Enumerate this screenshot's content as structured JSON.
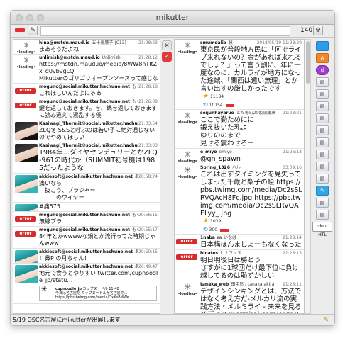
{
  "window": {
    "title": "mikutter"
  },
  "toolbar": {
    "post_placeholder": "",
    "char_count": "140",
    "settings_glyph": "⚙",
    "account_glyph": "✎"
  },
  "left_timeline": [
    {
      "avatar": "loading",
      "name": "hina@mstdn.maud.io",
      "sub": "五十嵐響子(JC13)",
      "time": "21:28:23",
      "text": "まあそうだよね"
    },
    {
      "avatar": "loading",
      "name": "unlimish@mstdn.maud.io",
      "sub": "Unlimish",
      "time": "21:28:12",
      "text": "https://mstdn.maud.io/media/8WW8nTItZx_d0vbvgLQ\nMikutterのゴリゴリオープンソースって感じな",
      "link": "https://mstdn.maud.io/media/8WW8nTItZx_d0vbvgLQ"
    },
    {
      "avatar": "error",
      "name": "moguno@social.mikutter.hachune.net",
      "sub": "もぐの",
      "time": "21:28:18",
      "text": "これほしいんだよにゃあ"
    },
    {
      "avatar": "error",
      "name": "moguno@social.mikutter.hachune.net",
      "sub": "もぐの",
      "time": "21:26:08",
      "text": "鍵を返しておきます。を、鍋を返しておきますに読み違えて混乱する僕"
    },
    {
      "avatar": "dark",
      "name": "Kasiwagi_Thermit@social.mikutter.hachune.net",
      "sub": "",
      "time": "21:03:54",
      "text": "ZLQ冬 S&Sと呼ぶのは若い子に絶対通じないのでやめてほしい"
    },
    {
      "avatar": "dark",
      "name": "Kasiwagi_Thermit@social.mikutter.hachune.net",
      "sub": "",
      "time": "21:03:03",
      "text": "1984年…ダイヤセンチュリーとかZLQ-961の時代か（SUMMIT初号機は1985だったような",
      "big": true
    },
    {
      "avatar": "anime",
      "name": "akkiesoft@social.mikutter.hachune.net",
      "sub": "あっきー",
      "time": "20:58:24",
      "text": "痛いなら\n　抜こう、プラジャー\n　　　のワイヤー"
    },
    {
      "avatar": "anime",
      "name": "",
      "sub": "",
      "time": "",
      "text": "#痛575",
      "link": "#痛575"
    },
    {
      "avatar": "error",
      "name": "moguno@social.mikutter.hachune.net",
      "sub": "もぐの",
      "time": "20:56:15",
      "text": "無線ブラ"
    },
    {
      "avatar": "error",
      "name": "moguno@social.mikutter.hachune.net",
      "sub": "もぐの",
      "time": "20:55:17",
      "text": "84年とかwwwwな鍋とか流行ってた時期じゃんwww"
    },
    {
      "avatar": "anime",
      "name": "akkiesoft@social.mikutter.hachune.net",
      "sub": "あっきー",
      "time": "20:50:15",
      "text": "！鼻P の月ちゃん！"
    },
    {
      "avatar": "anime",
      "name": "akkiesoft@social.mikutter.hachune.net",
      "sub": "あっきー",
      "time": "20:49:47",
      "text": "地元で食うとやりすい twitter.com/cupnoodle_jp/statu…",
      "link": "twitter.com/cupnoodle_jp/statu…",
      "preview": {
        "name": "cupnoodle_jp",
        "sub": "カップヌードル",
        "time": "11:48",
        "text": "今日は名古屋だ カップヌードルが名古屋で… https://pbs.twimg.com/media/DxXeBMWe..."
      }
    }
  ],
  "right_timeline": [
    {
      "avatar": "loading",
      "name": "smumdalia",
      "sub": "慧",
      "time": "2018/05/19 11:28:20",
      "text": "東京民が普段地方民に「何でライブ来れないの？金があれば来れるでしょ？」って言う割に、年に一度なのに、カルライが地方になった途端、「関西は遠い無理」とか言い出すの厳しかったです",
      "big": true,
      "favs": "11184",
      "rts": "10154"
    },
    {
      "avatar": "loading",
      "name": "seijunhayaruo",
      "sub": "とだ毎5/20仮説藤高",
      "time": "21:28:21",
      "text": "ここで勤ためにに\n鍛え抜いた乳よ\nゆりののまで\n見せる震わせろー",
      "big": true
    },
    {
      "avatar": "loading",
      "name": "e_miyo",
      "sub": "emiyo",
      "time": "21:26:13",
      "text": "@gn_spawn",
      "link": "@gn_spawn",
      "big": true
    },
    {
      "avatar": "loading",
      "name": "Spring_1326",
      "sub": "ハル",
      "time": "03:09:16",
      "text": "これは出すタイミングを見失ってしまった千歳と梨子の絵 https://pbs.twimg.com/media/Dc2sSLRVQAcH8Fc.jpg https://pbs.twimg.com/media/Dc2sSLRVQAELyy_.jpg",
      "big": true,
      "favs": "1039",
      "rts": "300"
    },
    {
      "avatar": "error",
      "name": "1naba_m",
      "sub": "いなば",
      "time": "21:28:14",
      "text": "日本構ほんましょーもなくなった",
      "big": true
    },
    {
      "avatar": "error",
      "name": "hinates",
      "sub": "ヒナフェス",
      "time": "21:28:13",
      "text": "明日明後日は勝とう\nさすがに1球団だけ最下位に負け越してるのは恥ずかしい",
      "big": true
    },
    {
      "avatar": "loading",
      "name": "tanaka_web",
      "sub": "田中彰 / tanaka akira",
      "time": "21:28:11",
      "text": "デザインシンキングとは、方法ではなく考え方だ-メルカリ流の実践方法・メルミライ - 未来を見るメディア mermirai.com/entry/design/th...",
      "link": "mermirai.com/entry/design/th...",
      "big": true
    }
  ],
  "right_tabs": [
    "twitter-tab",
    "orange-tab",
    "purple-tab",
    "list-tab-1",
    "list-tab-2",
    "list-tab-3",
    "list-tab-4",
    "list-tab-5",
    "list-tab-6",
    "list-tab-7",
    "list-tab-8",
    "list-tab-9",
    "pencil-tab",
    "list-tab-10",
    "list-tab-11"
  ],
  "right_tabs_text": ":don: HTL",
  "statusbar": {
    "text": "5/19 OSC名古屋にmikutterが出展します"
  },
  "colors": {
    "error_red": "#e03030",
    "link_blue": "#2a73d8",
    "star_gold": "#e0a800"
  }
}
